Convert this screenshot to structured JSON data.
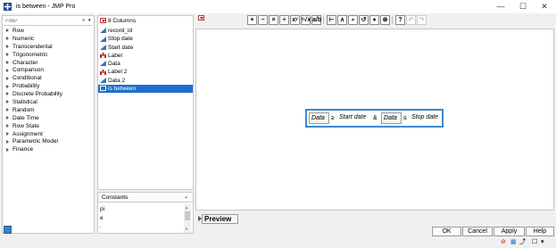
{
  "window": {
    "title": "is between - JMP Pro",
    "controls": {
      "minimize": "—",
      "maximize": "☐",
      "close": "✕"
    }
  },
  "functions": {
    "filter_placeholder": "Filter",
    "search_glyph": "⌕",
    "dropdown_glyph": "▾",
    "categories": [
      "Row",
      "Numeric",
      "Transcendental",
      "Trigonometric",
      "Character",
      "Comparison",
      "Conditional",
      "Probability",
      "Discrete Probability",
      "Statistical",
      "Random",
      "Date Time",
      "Row State",
      "Assignment",
      "Parametric Model",
      "Finance"
    ]
  },
  "columns": {
    "header": "8 Columns",
    "items": [
      {
        "label": "record_id",
        "icon": "continuous-icon"
      },
      {
        "label": "Stop date",
        "icon": "continuous-icon"
      },
      {
        "label": "Start date",
        "icon": "continuous-icon"
      },
      {
        "label": "Label",
        "icon": "nominal-icon"
      },
      {
        "label": "Data",
        "icon": "continuous-icon"
      },
      {
        "label": "Label 2",
        "icon": "nominal-icon"
      },
      {
        "label": "Data 2",
        "icon": "continuous-icon"
      },
      {
        "label": "is between",
        "icon": "continuous-icon",
        "selected": true
      }
    ]
  },
  "constants": {
    "title": "Constants",
    "dropdown_glyph": "⌄",
    "items": [
      "pi",
      "e",
      "."
    ]
  },
  "toolbar": {
    "buttons": [
      "+",
      "−",
      "×",
      "÷",
      "xʸ",
      "ʸ√x",
      "a/b",
      "⊢",
      "∧",
      "∘",
      "↺",
      "♦",
      "⊗",
      "?",
      "↶",
      "↷"
    ]
  },
  "formula": {
    "left_operand": "Data",
    "op1": "≥",
    "start": "Start date",
    "connector": "&",
    "right_operand": "Data",
    "op2": "≤",
    "stop": "Stop date"
  },
  "preview": {
    "label": "Preview"
  },
  "buttons": {
    "ok": "OK",
    "cancel": "Cancel",
    "apply": "Apply",
    "help": "Help"
  },
  "colors": {
    "accent": "#1e6fd0",
    "formula_border": "#3a8bd0",
    "red_menu": "#c00000"
  }
}
